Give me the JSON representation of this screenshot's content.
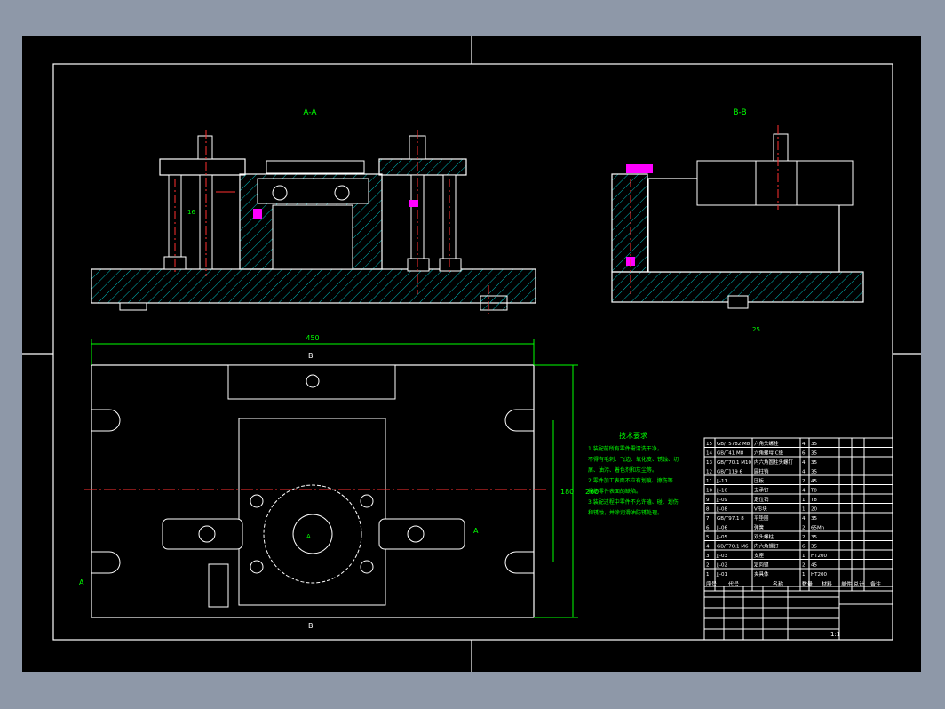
{
  "view_labels": {
    "front_section": "A-A",
    "side_section": "B-B",
    "top_cut_marker": "B",
    "bottom_cut_marker": "B",
    "left_cut_marker": "A",
    "right_cut_marker": "A",
    "center_marker": "A"
  },
  "dimensions": {
    "overall_width": "450",
    "overall_height": "260",
    "inner_height": "180",
    "bolt_height": "16",
    "slot_spacing": "25"
  },
  "tech_requirements": {
    "title": "技术要求",
    "lines": [
      "1.装配前所有零件需清洗干净，",
      "不得有毛刺、飞边、氧化皮、锈蚀、切",
      "屑、油污、着色剂和灰尘等。",
      "2.零件加工表面不应有划痕、擦伤等",
      "损伤零件表面的缺陷。",
      "3.装配过程中零件不允许磕、碰、划伤",
      "和锈蚀，并涂润滑油防锈处理。"
    ]
  },
  "bom": {
    "rows": [
      {
        "no": "15",
        "code": "GB/T5782 M8",
        "name": "六角头螺栓",
        "qty": "4",
        "mat": "35"
      },
      {
        "no": "14",
        "code": "GB/T41 M8",
        "name": "六角螺母 C级",
        "qty": "6",
        "mat": "35"
      },
      {
        "no": "13",
        "code": "GB/T70.1 M10",
        "name": "内六角圆柱头螺钉",
        "qty": "4",
        "mat": "35"
      },
      {
        "no": "12",
        "code": "GB/T119 6",
        "name": "圆柱销",
        "qty": "4",
        "mat": "35"
      },
      {
        "no": "11",
        "code": "JJ-11",
        "name": "压板",
        "qty": "2",
        "mat": "45"
      },
      {
        "no": "10",
        "code": "JJ-10",
        "name": "支承钉",
        "qty": "4",
        "mat": "T8"
      },
      {
        "no": "9",
        "code": "JJ-09",
        "name": "定位销",
        "qty": "1",
        "mat": "T8"
      },
      {
        "no": "8",
        "code": "JJ-08",
        "name": "V形块",
        "qty": "1",
        "mat": "20"
      },
      {
        "no": "7",
        "code": "GB/T97.1 8",
        "name": "平垫圈",
        "qty": "4",
        "mat": "35"
      },
      {
        "no": "6",
        "code": "JJ-06",
        "name": "弹簧",
        "qty": "2",
        "mat": "65Mn"
      },
      {
        "no": "5",
        "code": "JJ-05",
        "name": "双头螺柱",
        "qty": "2",
        "mat": "35"
      },
      {
        "no": "4",
        "code": "GB/T70.1 M6",
        "name": "内六角螺钉",
        "qty": "6",
        "mat": "35"
      },
      {
        "no": "3",
        "code": "JJ-03",
        "name": "支座",
        "qty": "1",
        "mat": "HT200"
      },
      {
        "no": "2",
        "code": "JJ-02",
        "name": "定向键",
        "qty": "2",
        "mat": "45"
      },
      {
        "no": "1",
        "code": "JJ-01",
        "name": "夹具体",
        "qty": "1",
        "mat": "HT200"
      }
    ],
    "header": {
      "no": "序号",
      "code": "代号",
      "name": "名称",
      "qty": "数量",
      "mat": "材料",
      "unit_weight": "单件",
      "total_weight": "总计",
      "remark": "备注"
    }
  },
  "title_block": {
    "scale": "1:1"
  },
  "colors": {
    "sheet_bg": "#000000",
    "outer_bg": "#8e98a8",
    "line": "#ffffff",
    "hatch": "#00c0c0",
    "dim": "#00ff00",
    "center": "#ff3030",
    "accent": "#ff00ff"
  }
}
